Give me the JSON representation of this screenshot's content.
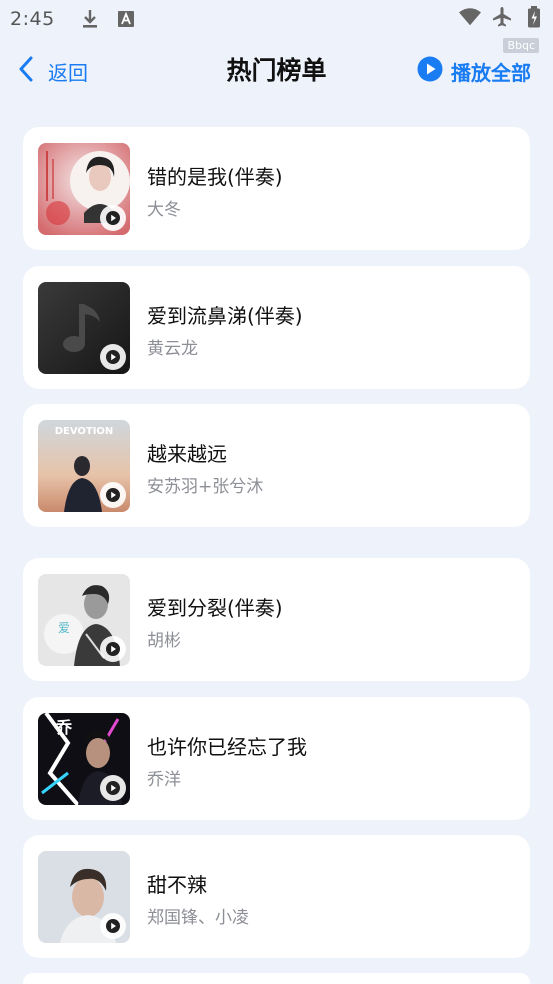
{
  "status_bar": {
    "time": "2:45",
    "icons": [
      "download-icon",
      "font-a-icon",
      "wifi-icon",
      "airplane-icon",
      "battery-icon"
    ],
    "watermark": "Bbqc"
  },
  "header": {
    "back_label": "返回",
    "title": "热门榜单",
    "play_all_label": "播放全部"
  },
  "colors": {
    "accent": "#1a7cf2",
    "background": "#eef2fb",
    "card": "#ffffff",
    "artist_text": "#8d8f96"
  },
  "songs": [
    {
      "title": "错的是我(伴奏)",
      "artist": "大冬"
    },
    {
      "title": "爱到流鼻涕(伴奏)",
      "artist": "黄云龙"
    },
    {
      "title": "越来越远",
      "artist": "安苏羽+张兮沐",
      "cover_text": "DEVOTION"
    },
    {
      "title": "爱到分裂(伴奏)",
      "artist": "胡彬"
    },
    {
      "title": "也许你已经忘了我",
      "artist": "乔洋"
    },
    {
      "title": "甜不辣",
      "artist": "郑国锋、小凌"
    }
  ]
}
